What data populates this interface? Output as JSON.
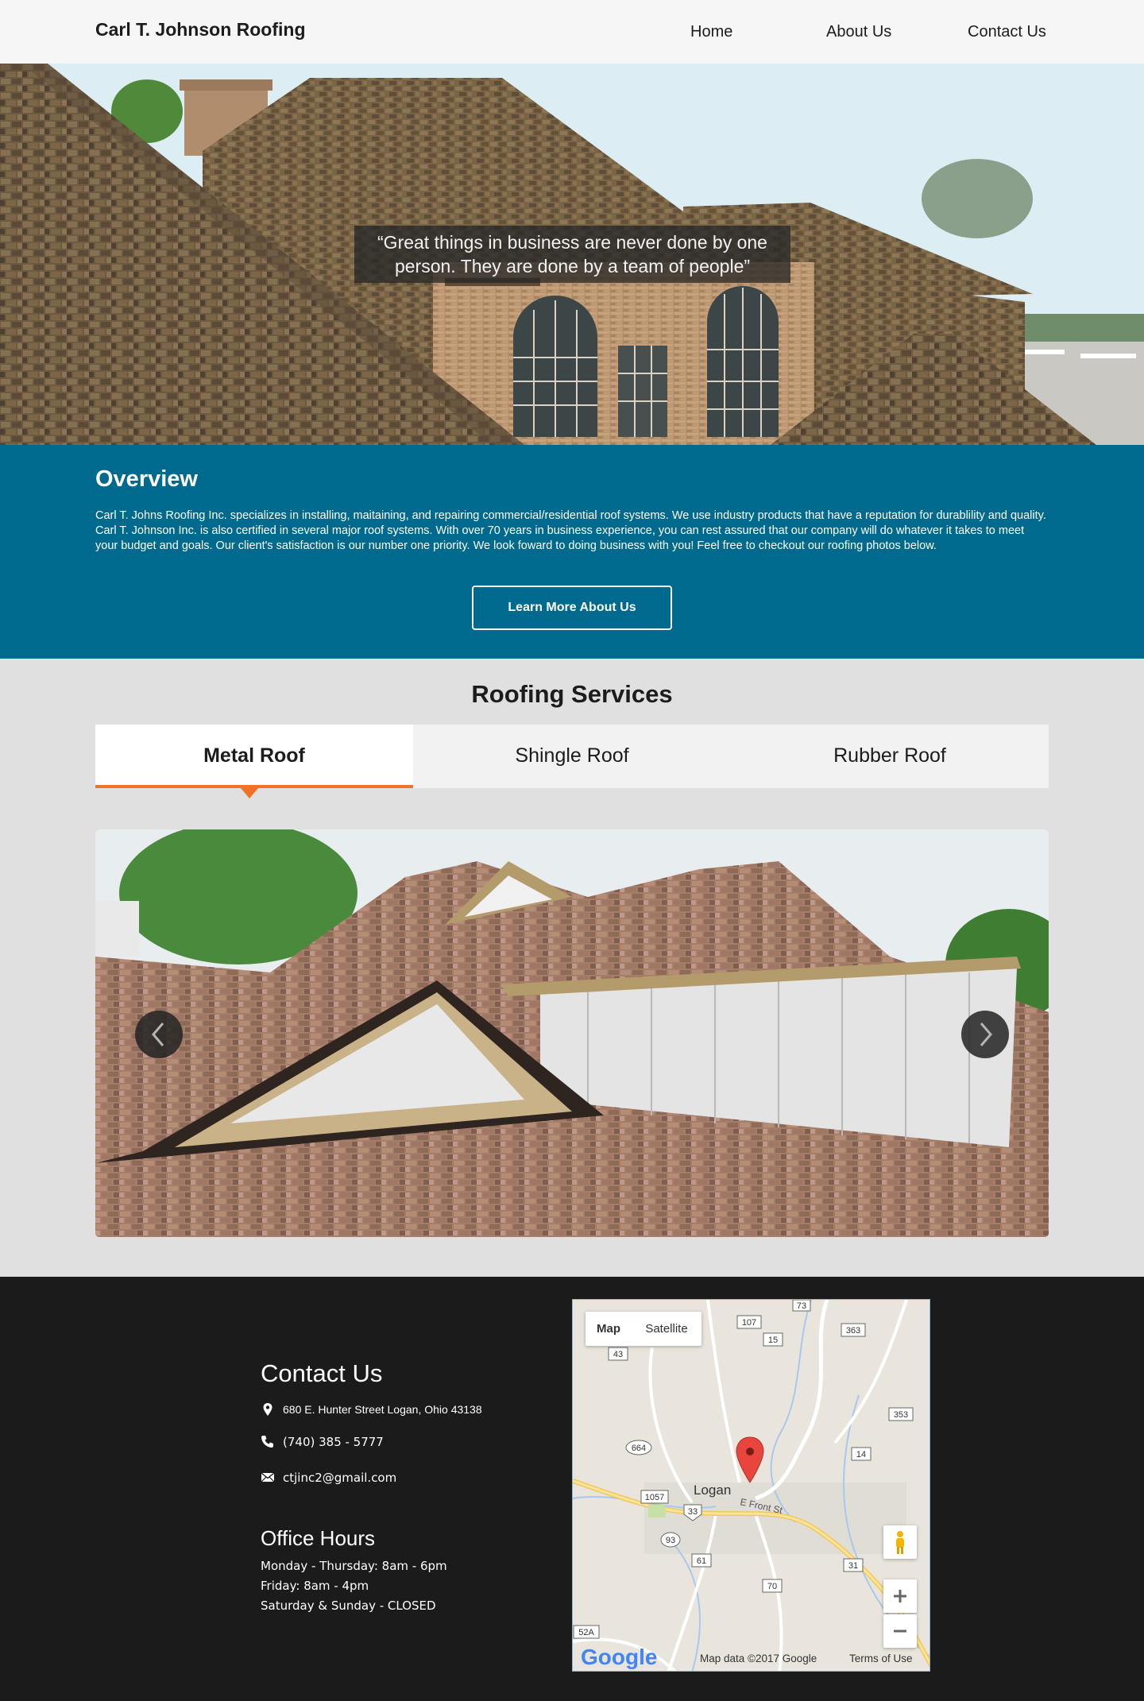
{
  "header": {
    "brand": "Carl T. Johnson Roofing",
    "nav": [
      "Home",
      "About Us",
      "Contact Us"
    ]
  },
  "hero": {
    "quote": "“Great things in business are never done by one person. They are done by a team of people”"
  },
  "overview": {
    "title": "Overview",
    "text": "Carl T. Johns Roofing Inc. specializes in installing, maitaining, and repairing commercial/residential roof systems. We use industry products that have a reputation for durablility and quality. Carl T. Johnson Inc. is also certified in several major roof systems. With over 70 years in business experience, you can rest assured that our company will do whatever it takes to meet your budget and goals. Our client's satisfaction is our number one priority. We look foward to doing business with you! Feel free to checkout our roofing photos below.",
    "button": "Learn More About Us"
  },
  "services": {
    "title": "Roofing Services",
    "tabs": [
      "Metal Roof",
      "Shingle Roof",
      "Rubber Roof"
    ],
    "active_tab": "Metal Roof"
  },
  "contact": {
    "title": "Contact Us",
    "address": "680 E. Hunter Street Logan, Ohio 43138",
    "phone": "(740) 385 - 5777",
    "email": "ctjinc2@gmail.com"
  },
  "hours": {
    "title": "Office Hours",
    "lines": [
      "Monday - Thursday: 8am - 6pm",
      "Friday: 8am - 4pm",
      "Saturday & Sunday - CLOSED"
    ]
  },
  "map": {
    "toggle_map": "Map",
    "toggle_satellite": "Satellite",
    "town": "Logan",
    "street": "E Front St",
    "route_shields": [
      "73",
      "107",
      "15",
      "363",
      "43",
      "353",
      "664",
      "14",
      "1057",
      "33",
      "93",
      "61",
      "31",
      "70",
      "52A"
    ],
    "logo": "Google",
    "attribution": "Map data ©2017 Google",
    "terms": "Terms of Use"
  },
  "colors": {
    "overview_bg": "#006a8e",
    "accent": "#f07227",
    "footer_bg": "#1b1b1b"
  }
}
